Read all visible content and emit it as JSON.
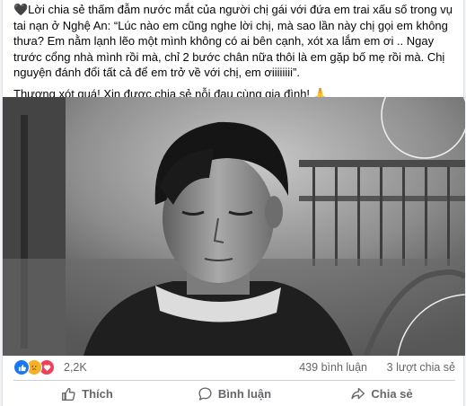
{
  "post": {
    "paragraph1": "🖤Lời chia sẻ thấm đẫm nước mắt của người chị gái với đứa em trai xấu số trong vụ tai nạn ở Nghệ An: “Lúc nào em cũng nghe lời chị, mà sao lần này chị gọi em không thưa? Em nằm lạnh lẽo một mình không có ai bên cạnh, xót xa lắm em ơi .. Ngay trước cổng nhà mình rồi mà, chỉ 2 bước chân nữa thôi là em gặp bố mẹ rồi mà. Chị nguyện đánh đổi tất cả để em trở về với chị, em ơiiiiiiii”.",
    "paragraph2": "Thương xót quá! Xin được chia sẻ nỗi đau cùng gia đình! 🙏",
    "emoji_line": "😭😭😭🙏🙏🙏"
  },
  "stats": {
    "reaction_count": "2,2K",
    "comments": "439 bình luận",
    "shares": "3 lượt chia sẻ"
  },
  "reaction_icons": [
    "like-icon",
    "sad-icon",
    "love-icon"
  ],
  "actions": {
    "like": "Thích",
    "comment": "Bình luận",
    "share": "Chia sẻ"
  },
  "colors": {
    "like_blue": "#1877f2",
    "sad_yellow": "#f7b125",
    "love_red": "#f33e58",
    "muted_text": "#65676b"
  }
}
